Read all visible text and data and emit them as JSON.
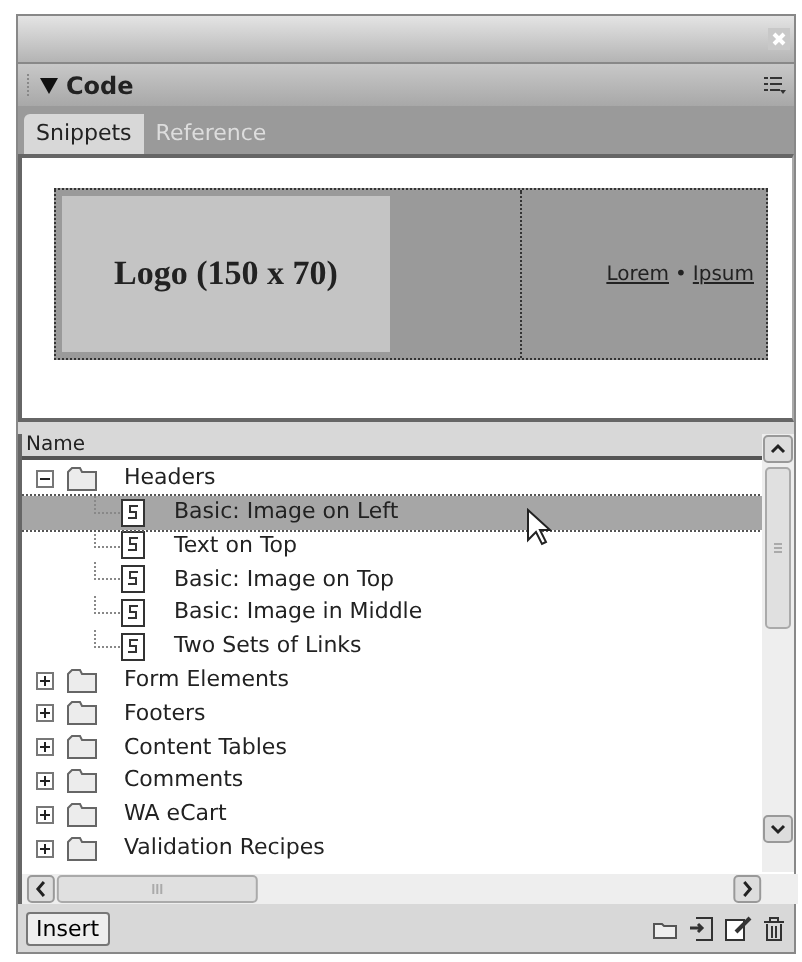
{
  "panel": {
    "title": "Code"
  },
  "tabs": [
    {
      "label": "Snippets",
      "selected": true
    },
    {
      "label": "Reference",
      "selected": false
    }
  ],
  "preview": {
    "logo_text": "Logo (150 x 70)",
    "links": [
      "Lorem",
      "Ipsum"
    ],
    "separator": "•"
  },
  "tree": {
    "column": "Name",
    "items": [
      {
        "label": "Headers",
        "kind": "folder",
        "expanded": true,
        "selected": false,
        "children": [
          {
            "label": "Basic: Image on Left",
            "kind": "snippet",
            "selected": true
          },
          {
            "label": "Text on Top",
            "kind": "snippet",
            "selected": false
          },
          {
            "label": "Basic: Image on Top",
            "kind": "snippet",
            "selected": false
          },
          {
            "label": "Basic: Image in Middle",
            "kind": "snippet",
            "selected": false
          },
          {
            "label": "Two Sets of Links",
            "kind": "snippet",
            "selected": false
          }
        ]
      },
      {
        "label": "Form Elements",
        "kind": "folder",
        "expanded": false,
        "selected": false
      },
      {
        "label": "Footers",
        "kind": "folder",
        "expanded": false,
        "selected": false
      },
      {
        "label": "Content Tables",
        "kind": "folder",
        "expanded": false,
        "selected": false
      },
      {
        "label": "Comments",
        "kind": "folder",
        "expanded": false,
        "selected": false
      },
      {
        "label": "WA eCart",
        "kind": "folder",
        "expanded": false,
        "selected": false
      },
      {
        "label": "Validation Recipes",
        "kind": "folder",
        "expanded": false,
        "selected": false
      }
    ]
  },
  "insert_button": "Insert"
}
